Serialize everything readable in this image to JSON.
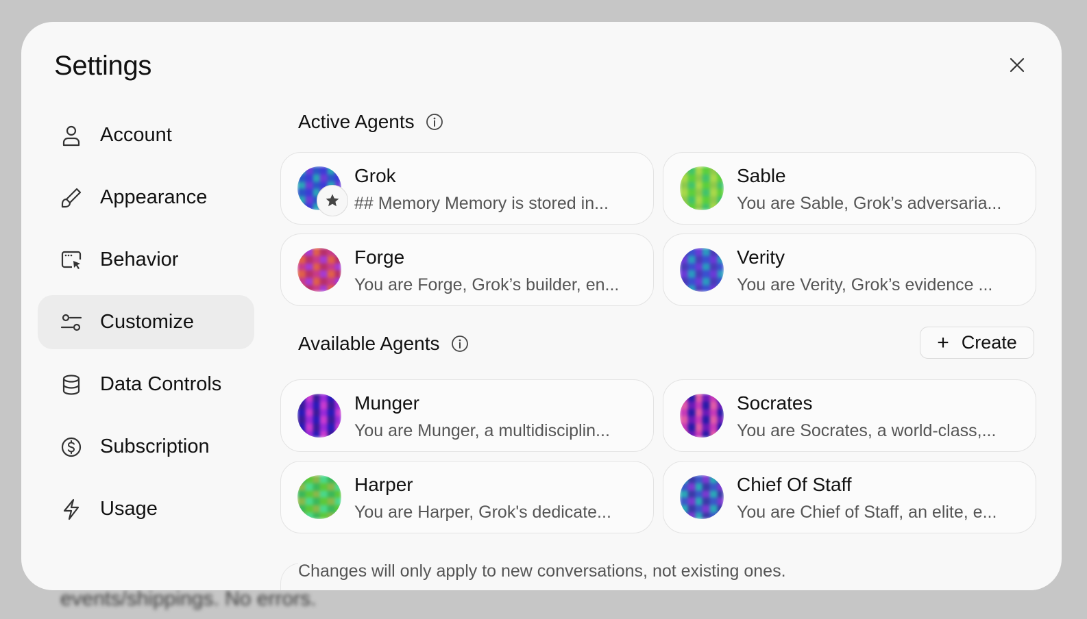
{
  "backdrop": {
    "text": "events/shippings. No errors."
  },
  "modal": {
    "title": "Settings"
  },
  "nav": {
    "items": [
      {
        "label": "Account",
        "icon": "user-icon"
      },
      {
        "label": "Appearance",
        "icon": "brush-icon"
      },
      {
        "label": "Behavior",
        "icon": "window-cursor-icon"
      },
      {
        "label": "Customize",
        "icon": "sliders-icon",
        "active": true
      },
      {
        "label": "Data Controls",
        "icon": "database-icon"
      },
      {
        "label": "Subscription",
        "icon": "dollar-circle-icon"
      },
      {
        "label": "Usage",
        "icon": "bolt-icon"
      }
    ]
  },
  "active_agents": {
    "heading": "Active Agents",
    "items": [
      {
        "name": "Grok",
        "desc": "## Memory Memory is stored in...",
        "colors": [
          "#2a56c8",
          "#3d3bd6",
          "#2aa3b8",
          "#6a3bd6"
        ],
        "starred": true
      },
      {
        "name": "Sable",
        "desc": "You are Sable, Grok’s adversaria...",
        "colors": [
          "#5ccf3c",
          "#8fc94a",
          "#42c46a",
          "#a8d84a"
        ]
      },
      {
        "name": "Forge",
        "desc": "You are Forge, Grok’s builder, en...",
        "colors": [
          "#c83a8a",
          "#a73ad0",
          "#e0604a",
          "#b8306a"
        ]
      },
      {
        "name": "Verity",
        "desc": "You are Verity, Grok’s evidence ...",
        "colors": [
          "#3a4fd0",
          "#6a3ad6",
          "#2a9ac0",
          "#4a3ab8"
        ]
      }
    ]
  },
  "available_agents": {
    "heading": "Available Agents",
    "create_label": "Create",
    "items": [
      {
        "name": "Munger",
        "desc": "You are Munger, a multidisciplin...",
        "colors": [
          "#9a2ad8",
          "#2a1ab8",
          "#c83ad0",
          "#3a1a9a"
        ]
      },
      {
        "name": "Socrates",
        "desc": "You are Socrates, a world-class,...",
        "colors": [
          "#c83ab8",
          "#2a1aa8",
          "#e05aa8",
          "#6a1ab8"
        ]
      },
      {
        "name": "Harper",
        "desc": "You are Harper, Grok's dedicate...",
        "colors": [
          "#5cc83a",
          "#8ab84a",
          "#4ad88a",
          "#3ab85a"
        ]
      },
      {
        "name": "Chief Of Staff",
        "desc": "You are Chief of Staff, an elite, e...",
        "colors": [
          "#3a58c8",
          "#7a3ad0",
          "#2aa8b8",
          "#3a3aa8"
        ]
      }
    ]
  },
  "footer": {
    "note": "Changes will only apply to new conversations, not existing ones."
  }
}
